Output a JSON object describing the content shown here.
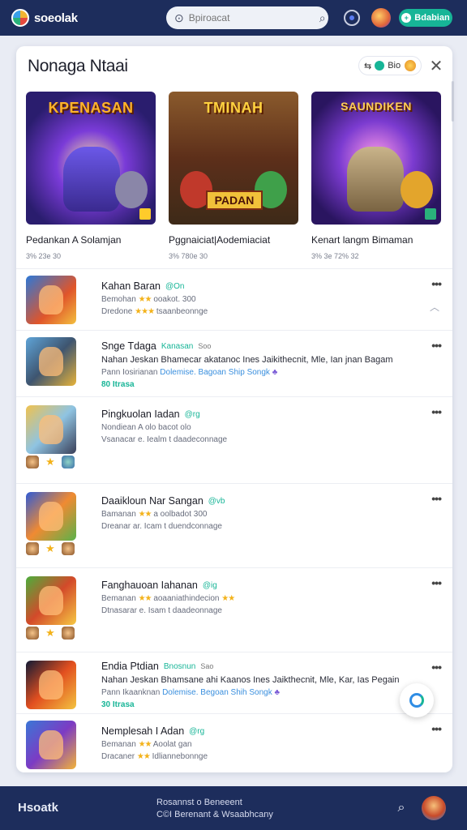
{
  "app": {
    "name": "soeolak"
  },
  "search": {
    "placeholder": "Bpiroacat"
  },
  "header_button": {
    "label": "Bdabian"
  },
  "panel": {
    "title": "Nonaga Ntaai",
    "pill_label": "Bio"
  },
  "featured": [
    {
      "art_label": "KPENASAN",
      "title": "Pedankan A Solamjan",
      "meta": "3% 23e 30"
    },
    {
      "art_label": "TMINAH",
      "banner": "PADAN",
      "title": "Pggnaiciat|Aodemiaciat",
      "meta": "3% 780e 30"
    },
    {
      "art_label": "SAUNDIKEN",
      "title": "Kenart langm Bimaman",
      "meta": "3% 3e 72% 32"
    }
  ],
  "items": [
    {
      "title": "Kahan Baran",
      "tag": "@On",
      "line1_a": "Bemohan",
      "line1_stars": "★★",
      "line1_b": "ooakot. 300",
      "line2_a": "Dredone",
      "line2_stars": "★★★",
      "line2_b": "tsaanbeonnge"
    },
    {
      "title": "Snge Tdaga",
      "tag": "Kanasan",
      "tag2": "Soo",
      "desc": "Nahan Jeskan Bhamecar akatanoc Ines Jaikithecnit, Mle, Ian jnan Bagam",
      "line2_a": "Pann Iosirianan",
      "line2_b": "Dolemise. Bagoan Ship Songk",
      "count": "80 Itrasa"
    },
    {
      "title": "Pingkuolan Iadan",
      "tag": "@rg",
      "line1_a": "Nondiean",
      "line1_b": "A olo bacot olo",
      "line2_a": "Vsanacar e. Iealm t daadeconnage"
    },
    {
      "title": "Daaikloun Nar Sangan",
      "tag": "@vb",
      "line1_a": "Bamanan",
      "line1_stars": "★★",
      "line1_b": "a oolbadot 300",
      "line2_a": "Dreanar ar. Icam t duendconnage"
    },
    {
      "title": "Fanghauoan Iahanan",
      "tag": "@ig",
      "line1_a": "Bemanan",
      "line1_stars": "★★",
      "line1_b": "aoaaniathindecion",
      "line1_stars2": "★★",
      "line2_a": "Dtnasarar e. Isam t daadeonnage"
    },
    {
      "title": "Endia Ptdian",
      "tag": "Bnosnun",
      "tag2": "Sao",
      "desc": "Nahan Jeskan Bhamsane ahi Kaanos Ines Jaikthecnit, Mle, Kar, Ias Pegain",
      "line2_a": "Pann Ikaanknan",
      "line2_b": "Dolemise. Begoan Shih Songk",
      "count": "30 Itrasa"
    },
    {
      "title": "Nemplesah I Adan",
      "tag": "@rg",
      "line1_a": "Bemanan",
      "line1_stars": "★★",
      "line1_b": "Aoolat gan",
      "line2_a": "Dracaner",
      "line2_stars": "★★",
      "line2_b": "Idliannebonnge"
    }
  ],
  "footer": {
    "logo": "Hsoatk",
    "line1": "Rosannst o Beneeent",
    "line2": "C©I Berenant & Wsaabhcany"
  }
}
